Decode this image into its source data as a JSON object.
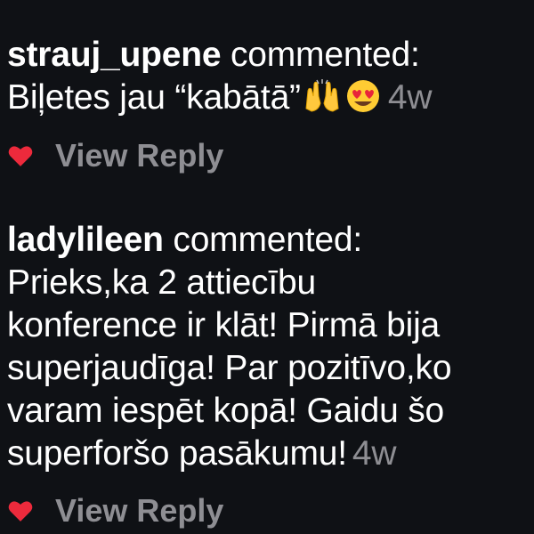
{
  "comments": [
    {
      "username": "strauj_upene",
      "verb": "commented:",
      "text_lines": [
        "Biļetes jau “kabātā”"
      ],
      "emojis": [
        "raising-hands-emoji",
        "heart-eyes-emoji"
      ],
      "time": "4w",
      "liked": true,
      "reply_label": "View Reply"
    },
    {
      "username": "ladylileen",
      "verb": "commented:",
      "text_lines": [
        "Prieks,ka 2 attiecību",
        "konference ir klāt! Pirmā bija",
        "superjaudīga! Par pozitīvo,ko",
        "varam iespēt kopā! Gaidu šo",
        "superforšo pasākumu!"
      ],
      "time": "4w",
      "liked": true,
      "reply_label": "View Reply"
    }
  ],
  "colors": {
    "background": "#0f1115",
    "text": "#ffffff",
    "muted": "#8e8e93",
    "heart": "#ed2a3c"
  }
}
